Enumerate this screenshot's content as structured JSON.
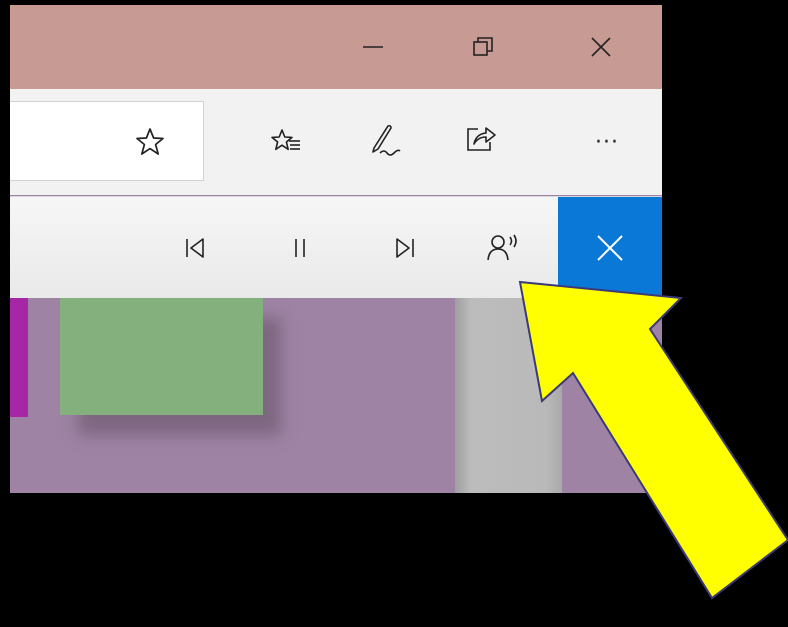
{
  "window": {
    "titlebar": {
      "color": "#c79b94",
      "buttons": [
        {
          "icon": "minimize-icon"
        },
        {
          "icon": "restore-icon"
        },
        {
          "icon": "close-icon"
        }
      ]
    },
    "address_bar": {
      "value": "",
      "favorite_icon": "star-icon"
    },
    "toolbar": {
      "icons": [
        "favorites-list-icon",
        "pen-icon",
        "share-icon",
        "more-icon"
      ],
      "more_label": "···"
    },
    "read_aloud_bar": {
      "buttons": [
        "previous-icon",
        "pause-icon",
        "next-icon",
        "voice-settings-icon"
      ],
      "close_color": "#0a78d7"
    },
    "page": {
      "background": "#9e83a4",
      "card_color": "#84b07e",
      "strip_color": "#a626a6"
    }
  },
  "annotation": {
    "arrow_color": "#ffff00",
    "points_to": "voice-settings-icon"
  }
}
